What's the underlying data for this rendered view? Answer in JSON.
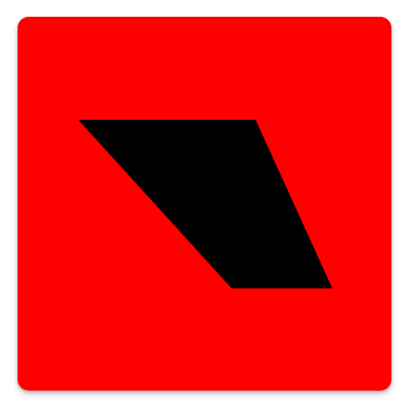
{
  "icon": {
    "name": "black-parallelogram-on-red-icon",
    "colors": {
      "background": "#ff0000",
      "shape": "#000000"
    }
  }
}
